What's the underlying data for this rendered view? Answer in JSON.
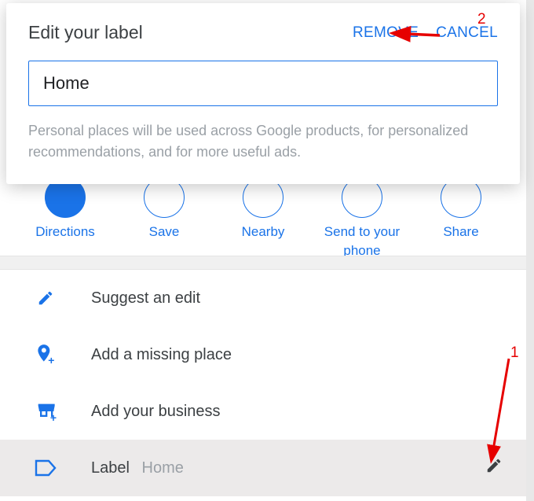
{
  "modal": {
    "title": "Edit your label",
    "remove": "REMOVE",
    "cancel": "CANCEL",
    "input_value": "Home",
    "description": "Personal places will be used across Google products, for personalized recommendations, and for more useful ads."
  },
  "actions": {
    "directions": "Directions",
    "save": "Save",
    "nearby": "Nearby",
    "send": "Send to your phone",
    "share": "Share"
  },
  "list": {
    "suggest_edit": "Suggest an edit",
    "add_missing": "Add a missing place",
    "add_business": "Add your business",
    "label": "Label",
    "label_value": "Home"
  },
  "annotations": {
    "n1": "1",
    "n2": "2"
  }
}
